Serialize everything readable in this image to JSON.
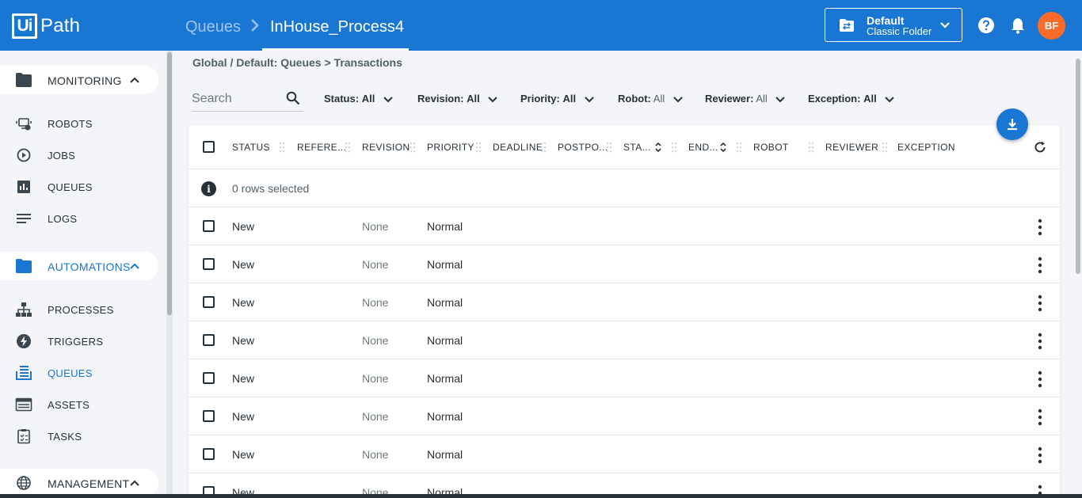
{
  "header": {
    "logo_box": "Ui",
    "logo_text": "Path",
    "breadcrumb_parent": "Queues",
    "breadcrumb_current": "InHouse_Process4",
    "folder_name": "Default",
    "folder_type": "Classic Folder",
    "avatar_initials": "BF",
    "accent_color": "#1976d2",
    "avatar_color": "#fa6b2a"
  },
  "sidebar": {
    "monitoring": {
      "label": "MONITORING",
      "items": [
        "ROBOTS",
        "JOBS",
        "QUEUES",
        "LOGS"
      ]
    },
    "automations": {
      "label": "AUTOMATIONS",
      "items": [
        "PROCESSES",
        "TRIGGERS",
        "QUEUES",
        "ASSETS",
        "TASKS"
      ],
      "active_item": "QUEUES"
    },
    "management": {
      "label": "MANAGEMENT"
    }
  },
  "page": {
    "path": "Global / Default: Queues > Transactions",
    "search_placeholder": "Search",
    "filters": [
      {
        "label": "Status:",
        "value": "All"
      },
      {
        "label": "Revision:",
        "value": "All"
      },
      {
        "label": "Priority:",
        "value": "All"
      },
      {
        "label": "Robot:",
        "value": "All"
      },
      {
        "label": "Reviewer:",
        "value": "All"
      },
      {
        "label": "Exception:",
        "value": "All"
      }
    ]
  },
  "table": {
    "columns": [
      "STATUS",
      "REFERE...",
      "REVISION",
      "PRIORITY",
      "DEADLINE",
      "POSTPO...",
      "STA...",
      "END...",
      "ROBOT",
      "REVIEWER",
      "EXCEPTION"
    ],
    "selection_text": "0 rows selected",
    "rows": [
      {
        "status": "New",
        "revision": "None",
        "priority": "Normal"
      },
      {
        "status": "New",
        "revision": "None",
        "priority": "Normal"
      },
      {
        "status": "New",
        "revision": "None",
        "priority": "Normal"
      },
      {
        "status": "New",
        "revision": "None",
        "priority": "Normal"
      },
      {
        "status": "New",
        "revision": "None",
        "priority": "Normal"
      },
      {
        "status": "New",
        "revision": "None",
        "priority": "Normal"
      },
      {
        "status": "New",
        "revision": "None",
        "priority": "Normal"
      },
      {
        "status": "New",
        "revision": "None",
        "priority": "Normal"
      }
    ]
  }
}
